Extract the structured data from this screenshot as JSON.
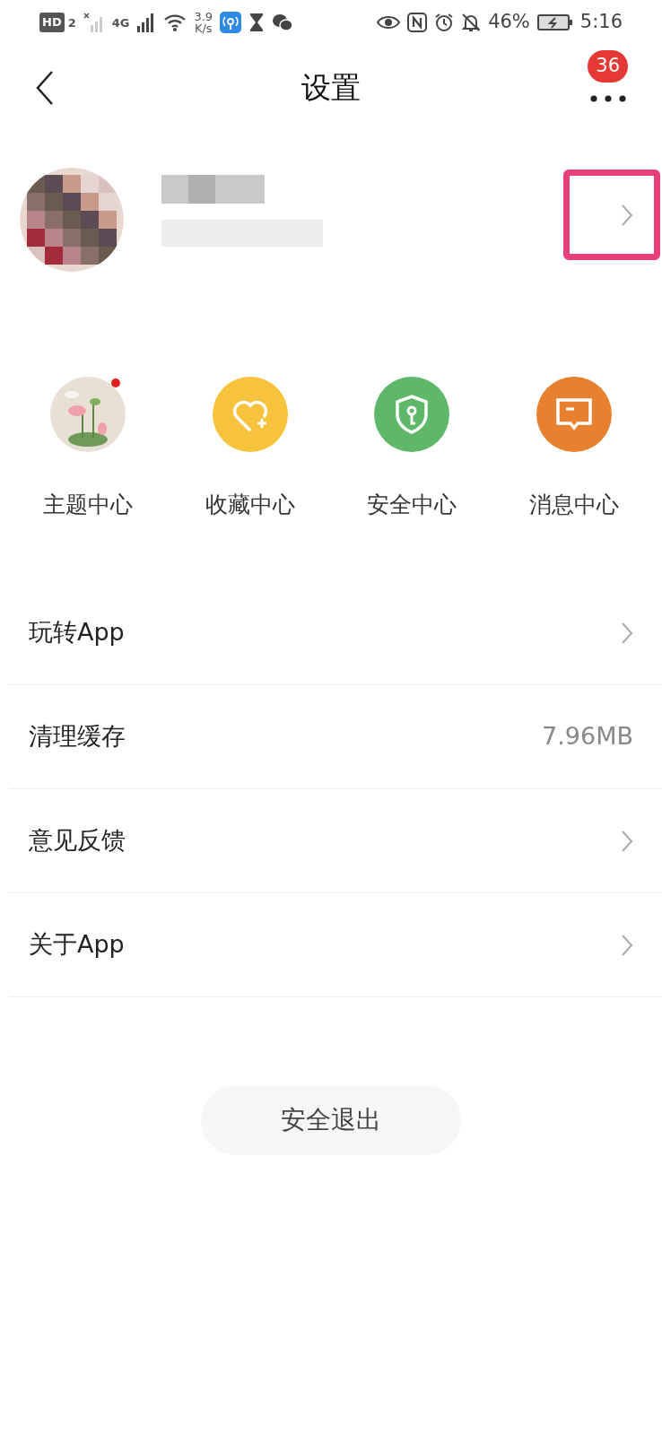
{
  "status_bar": {
    "network_badge": "HD",
    "sim_number": "2",
    "network_type": "4G",
    "speed_value": "3.9",
    "speed_unit": "K/s",
    "battery_percent": "46%",
    "time": "5:16"
  },
  "header": {
    "title": "设置",
    "badge": "36"
  },
  "profile": {
    "highlighted": true
  },
  "shortcuts": [
    {
      "label": "主题中心",
      "kind": "theme",
      "color": "#e8e0d4",
      "dot": true
    },
    {
      "label": "收藏中心",
      "kind": "heart",
      "color": "#f7c33c",
      "dot": false
    },
    {
      "label": "安全中心",
      "kind": "shield",
      "color": "#5fb86a",
      "dot": false
    },
    {
      "label": "消息中心",
      "kind": "message",
      "color": "#e8812f",
      "dot": false
    }
  ],
  "settings": [
    {
      "label": "玩转App",
      "kind": "link"
    },
    {
      "label": "清理缓存",
      "kind": "value",
      "value": "7.96MB"
    },
    {
      "label": "意见反馈",
      "kind": "link"
    },
    {
      "label": "关于App",
      "kind": "link"
    }
  ],
  "logout_button": "安全退出"
}
